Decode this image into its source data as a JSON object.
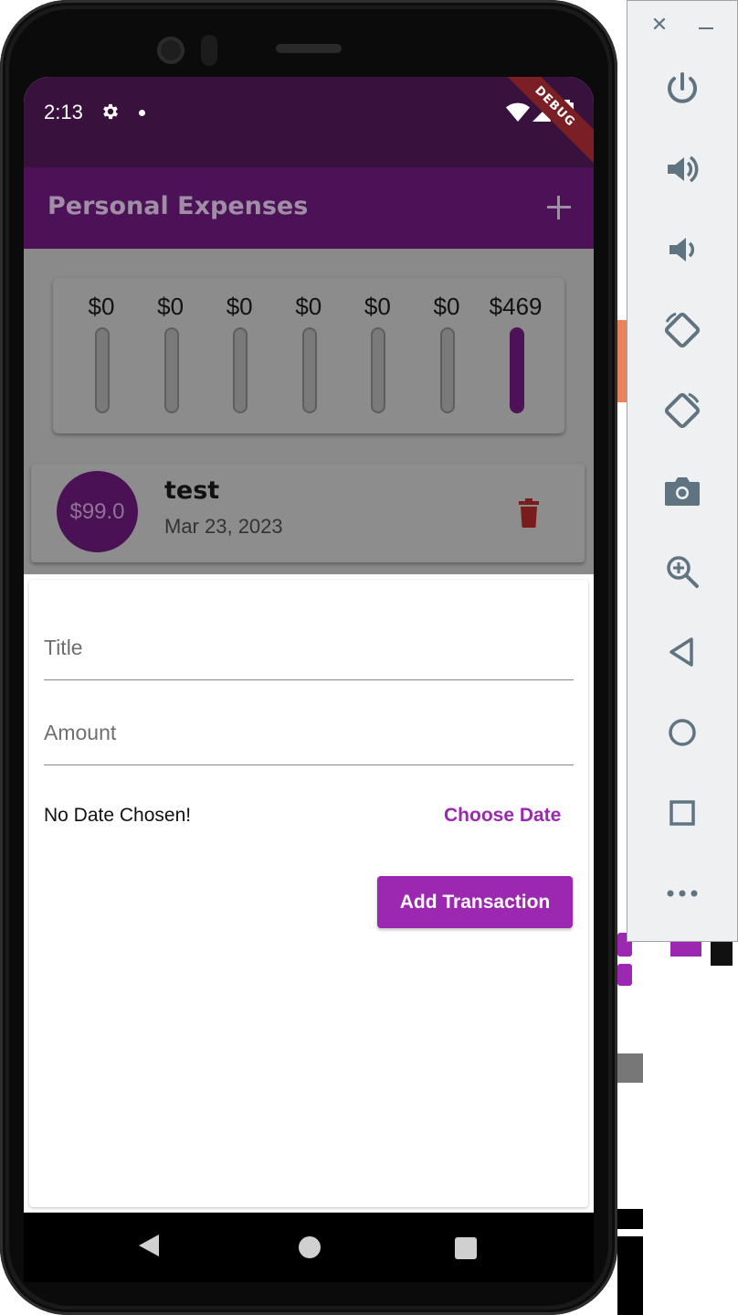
{
  "status_bar": {
    "time": "2:13",
    "debug_banner": "DEBUG"
  },
  "app_bar": {
    "title": "Personal Expenses"
  },
  "chart": {
    "bars": [
      {
        "label": "$0",
        "fill": 0
      },
      {
        "label": "$0",
        "fill": 0
      },
      {
        "label": "$0",
        "fill": 0
      },
      {
        "label": "$0",
        "fill": 0
      },
      {
        "label": "$0",
        "fill": 0
      },
      {
        "label": "$0",
        "fill": 0
      },
      {
        "label": "$469",
        "fill": 1
      }
    ]
  },
  "transactions": [
    {
      "amount": "$99.0",
      "title": "test",
      "date": "Mar 23, 2023"
    }
  ],
  "new_transaction": {
    "title_placeholder": "Title",
    "amount_placeholder": "Amount",
    "date_status": "No Date Chosen!",
    "choose_date_label": "Choose Date",
    "submit_label": "Add Transaction"
  },
  "colors": {
    "primary": "#9c27b0",
    "app_bar": "#4c1156",
    "status_bar": "#39113d"
  },
  "emulator_panel": {
    "icons": [
      "power-icon",
      "volume-up-icon",
      "volume-down-icon",
      "rotate-left-icon",
      "rotate-right-icon",
      "camera-icon",
      "zoom-icon",
      "back-icon",
      "home-icon",
      "overview-icon",
      "more-icon"
    ]
  }
}
